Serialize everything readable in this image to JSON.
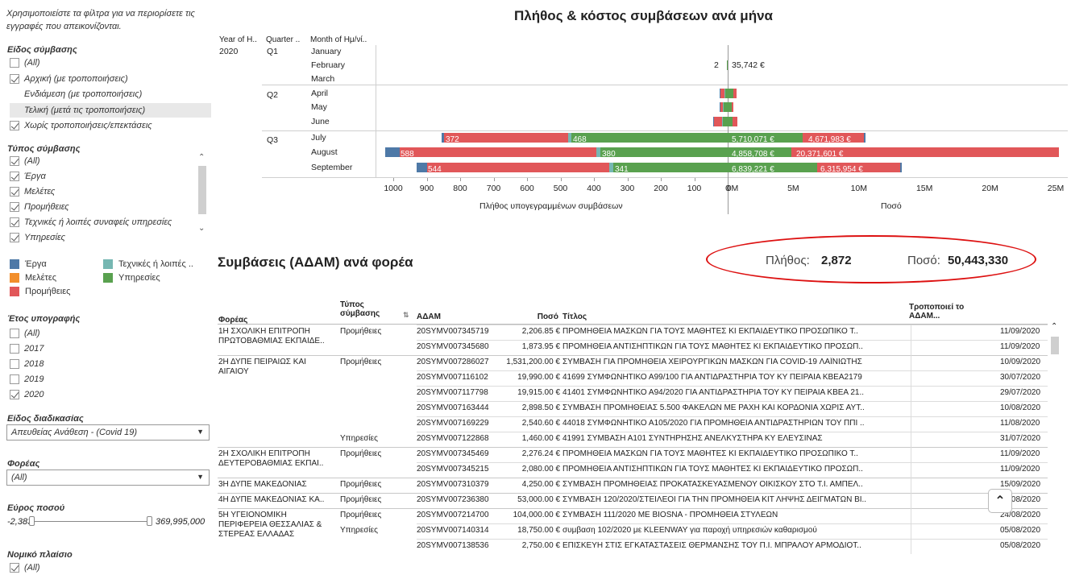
{
  "sidebar": {
    "note": "Χρησιμοποιείστε τα φίλτρα για να περιορίσετε τις εγγραφές που απεικονίζονται.",
    "contract_kind": {
      "title": "Είδος σύμβασης",
      "items": [
        {
          "label": "(All)",
          "checked": false
        },
        {
          "label": "Αρχική (με τροποποιήσεις)",
          "checked": true
        },
        {
          "label": "Ενδιάμεση (με τροποποιήσεις)",
          "checked": null
        },
        {
          "label": "Τελική (μετά τις τροποποιήσεις)",
          "checked": null
        },
        {
          "label": "Χωρίς τροποποιήσεις/επεκτάσεις",
          "checked": true
        }
      ]
    },
    "contract_type": {
      "title": "Τύπος σύμβασης",
      "items": [
        {
          "label": "(All)",
          "checked": true
        },
        {
          "label": "Έργα",
          "checked": true
        },
        {
          "label": "Μελέτες",
          "checked": true
        },
        {
          "label": "Προμήθειες",
          "checked": true
        },
        {
          "label": "Τεχνικές ή λοιπές συναφείς υπηρεσίες",
          "checked": true
        },
        {
          "label": "Υπηρεσίες",
          "checked": true
        }
      ]
    },
    "legend": [
      {
        "label": "Έργα",
        "color": "#4e79a7"
      },
      {
        "label": "Τεχνικές ή λοιπές ..",
        "color": "#76b7b2"
      },
      {
        "label": "Μελέτες",
        "color": "#f28e2b"
      },
      {
        "label": "Υπηρεσίες",
        "color": "#59a14f"
      },
      {
        "label": "Προμήθειες",
        "color": "#e15759"
      }
    ],
    "sign_year": {
      "title": "Έτος υπογραφής",
      "items": [
        {
          "label": "(All)",
          "checked": false
        },
        {
          "label": "2017",
          "checked": false
        },
        {
          "label": "2018",
          "checked": false
        },
        {
          "label": "2019",
          "checked": false
        },
        {
          "label": "2020",
          "checked": true
        }
      ]
    },
    "procedure": {
      "title": "Είδος διαδικασίας",
      "value": "Απευθείας Ανάθεση - (Covid 19)"
    },
    "body": {
      "title": "Φορέας",
      "value": "(All)"
    },
    "amount_range": {
      "title": "Εύρος ποσού",
      "min": "-2,383",
      "max": "369,995,000"
    },
    "legal": {
      "title": "Νομικό πλαίσιο",
      "first": "(All)"
    }
  },
  "chart": {
    "title": "Πλήθος & κόστος συμβάσεων ανά μήνα",
    "headers": {
      "year": "Year of H..",
      "quarter": "Quarter ..",
      "month": "Month of Ημ/νί.."
    },
    "year": "2020",
    "quarters": [
      "Q1",
      "Q2",
      "Q3"
    ],
    "left_axis_title": "Πλήθος υπογεγραμμένων συμβάσεων",
    "right_axis_title": "Ποσό",
    "left_ticks": [
      "1000",
      "900",
      "800",
      "700",
      "600",
      "500",
      "400",
      "300",
      "200",
      "100",
      "0"
    ],
    "right_ticks": [
      "0M",
      "5M",
      "10M",
      "15M",
      "20M",
      "25M"
    ]
  },
  "chart_data": {
    "type": "bar",
    "title": "Πλήθος & κόστος συμβάσεων ανά μήνα",
    "categories": [
      "January",
      "February",
      "March",
      "April",
      "May",
      "June",
      "July",
      "August",
      "September"
    ],
    "count_xlim": [
      0,
      1000
    ],
    "amount_xlim": [
      0,
      25000000
    ],
    "count_series": [
      {
        "name": "Έργα",
        "values": [
          0,
          0,
          0,
          3,
          2,
          3,
          8,
          45,
          30
        ]
      },
      {
        "name": "Τεχνικές ή λοιπές ..",
        "values": [
          0,
          0,
          0,
          2,
          2,
          2,
          8,
          12,
          14
        ]
      },
      {
        "name": "Υπηρεσίες",
        "values": [
          0,
          2,
          0,
          8,
          12,
          16,
          468,
          380,
          341
        ]
      },
      {
        "name": "Προμήθειες",
        "values": [
          0,
          0,
          0,
          12,
          8,
          22,
          372,
          588,
          544
        ]
      }
    ],
    "amount_series": [
      {
        "name": "Υπηρεσίες",
        "values": [
          0,
          35742,
          0,
          400000,
          300000,
          350000,
          5710071,
          4858708,
          6839221
        ]
      },
      {
        "name": "Προμήθειες",
        "values": [
          0,
          0,
          0,
          300000,
          150000,
          400000,
          4671983,
          20371601,
          6315954
        ]
      },
      {
        "name": "Έργα",
        "values": [
          0,
          0,
          0,
          0,
          0,
          0,
          100000,
          0,
          100000
        ]
      }
    ],
    "annotations": {
      "february_count": "2",
      "february_amount": "35,742 €"
    },
    "bar_labels": {
      "count_july": [
        "372",
        "468"
      ],
      "count_august": [
        "588",
        "380"
      ],
      "count_september": [
        "544",
        "341"
      ],
      "amount_july": [
        "5,710,071 €",
        "4,671,983 €"
      ],
      "amount_august": [
        "4,858,708 €",
        "20,371,601 €"
      ],
      "amount_september": [
        "6,839,221 €",
        "6,315,954 €"
      ]
    }
  },
  "kpi": {
    "title": "Συμβάσεις (ΑΔΑΜ) ανά φορέα",
    "count_label": "Πλήθος:",
    "count_value": "2,872",
    "amount_label": "Ποσό:",
    "amount_value": "50,443,330"
  },
  "table": {
    "headers": {
      "body": "Φορέας",
      "type": "Τύπος σύμβασης",
      "adam": "ΑΔΑΜ",
      "amount": "Ποσό",
      "title": "Τίτλος",
      "modifies": "Τροποποιεί το ΑΔΑΜ..."
    },
    "rows": [
      {
        "body": "1Η ΣΧΟΛΙΚΗ ΕΠΙΤΡΟΠΗ ΠΡΩΤΟΒΑΘΜΙΑΣ ΕΚΠΑΙΔΕ..",
        "type": "Προμήθειες",
        "adam": "20SYMV007345719",
        "amount": "2,206.85 €",
        "title": "ΠΡΟΜΗΘΕΙΑ  ΜΑΣΚΩΝ  ΓΙΑ ΤΟΥΣ ΜΑΘΗΤΕΣ ΚΙ ΕΚΠΑΙΔΕΥΤΙΚΟ ΠΡΟΣΩΠΙΚΟ Τ..",
        "date": "11/09/2020"
      },
      {
        "body": "",
        "type": "",
        "adam": "20SYMV007345680",
        "amount": "1,873.95 €",
        "title": "ΠΡΟΜΗΘΕΙΑ ΑΝΤΙΣΗΠΤΙΚΩΝ  ΓΙΑ ΤΟΥΣ ΜΑΘΗΤΕΣ ΚΙ ΕΚΠΑΙΔΕΥΤΙΚΟ ΠΡΟΣΩΠ..",
        "date": "11/09/2020"
      },
      {
        "body": "2Η ΔΥΠΕ ΠΕΙΡΑΙΩΣ ΚΑΙ ΑΙΓΑΙΟΥ",
        "type": "Προμήθειες",
        "adam": "20SYMV007286027",
        "amount": "1,531,200.00 €",
        "title": "ΣΥΜΒΑΣΗ ΓΙΑ ΠΡΟΜΗΘΕΙΑ ΧΕΙΡΟΥΡΓΙΚΩΝ ΜΑΣΚΩΝ ΓΙΑ COVID-19 ΛΑΪΝΙΩΤΗΣ",
        "date": "10/09/2020"
      },
      {
        "body": "",
        "type": "",
        "adam": "20SYMV007116102",
        "amount": "19,990.00 €",
        "title": "41699 ΣΥΜΦΩΝΗΤΙΚΟ Α99/100 ΓΙΑ ΑΝΤΙΔΡΑΣΤΗΡΙΑ ΤΟΥ ΚΥ ΠΕΙΡΑΙΑ ΚΒΕΑ2179",
        "date": "30/07/2020"
      },
      {
        "body": "",
        "type": "",
        "adam": "20SYMV007117798",
        "amount": "19,915.00 €",
        "title": "41401 ΣΥΜΦΩΝΗΤΙΚΟ Α94/2020 ΓΙΑ ΑΝΤΙΔΡΑΣΤΗΡΙΑ ΤΟΥ ΚΥ ΠΕΙΡΑΙΑ ΚΒΕΑ 21..",
        "date": "29/07/2020"
      },
      {
        "body": "",
        "type": "",
        "adam": "20SYMV007163444",
        "amount": "2,898.50 €",
        "title": "ΣΥΜΒΑΣΗ ΠΡΟΜΗΘΕΙΑΣ 5.500 ΦΑΚΕΛΩΝ ΜΕ ΡΑΧΗ ΚΑΙ ΚΟΡΔΟΝΙΑ ΧΩΡΙΣ ΑΥΤ..",
        "date": "10/08/2020"
      },
      {
        "body": "",
        "type": "",
        "adam": "20SYMV007169229",
        "amount": "2,540.60 €",
        "title": "44018 ΣΥΜΦΩΝΗΤΙΚΟ Α105/2020 ΓΙΑ ΠΡΟΜΗΘΕΙΑ ΑΝΤΙΔΡΑΣΤΗΡΙΩΝ ΤΟΥ ΠΠΙ ..",
        "date": "11/08/2020"
      },
      {
        "body": "",
        "type": "Υπηρεσίες",
        "adam": "20SYMV007122868",
        "amount": "1,460.00 €",
        "title": "41991 ΣΥΜΒΑΣΗ Α101 ΣΥΝΤΗΡΗΣΗΣ ΑΝΕΛΚΥΣΤΗΡΑ ΚΥ ΕΛΕΥΣΙΝΑΣ",
        "date": "31/07/2020"
      },
      {
        "body": "2Η ΣΧΟΛΙΚΗ ΕΠΙΤΡΟΠΗ ΔΕΥΤΕΡΟΒΑΘΜΙΑΣ ΕΚΠΑΙ..",
        "type": "Προμήθειες",
        "adam": "20SYMV007345469",
        "amount": "2,276.24 €",
        "title": "ΠΡΟΜΗΘΕΙΑ  ΜΑΣΚΩΝ  ΓΙΑ ΤΟΥΣ ΜΑΘΗΤΕΣ ΚΙ ΕΚΠΑΙΔΕΥΤΙΚΟ ΠΡΟΣΩΠΙΚΟ Τ..",
        "date": "11/09/2020"
      },
      {
        "body": "",
        "type": "",
        "adam": "20SYMV007345215",
        "amount": "2,080.00 €",
        "title": "ΠΡΟΜΗΘΕΙΑ ΑΝΤΙΣΗΠΤΙΚΩΝ  ΓΙΑ ΤΟΥΣ ΜΑΘΗΤΕΣ ΚΙ ΕΚΠΑΙΔΕΥΤΙΚΟ ΠΡΟΣΩΠ..",
        "date": "11/09/2020"
      },
      {
        "body": "3Η ΔΥΠΕ ΜΑΚΕΔΟΝΙΑΣ",
        "type": "Προμήθειες",
        "adam": "20SYMV007310379",
        "amount": "4,250.00 €",
        "title": "ΣΥΜΒΑΣΗ ΠΡΟΜΗΘΕΙΑΣ ΠΡΟΚΑΤΑΣΚΕΥΑΣΜΕΝΟΥ ΟΙΚΙΣΚΟΥ ΣΤΟ Τ.Ι. ΑΜΠΕΛ..",
        "date": "15/09/2020"
      },
      {
        "body": "4Η ΔΥΠΕ ΜΑΚΕΔΟΝΙΑΣ ΚΑ..",
        "type": "Προμήθειες",
        "adam": "20SYMV007236380",
        "amount": "53,000.00 €",
        "title": "ΣΥΜΒΑΣΗ 120/2020/ΣΤΕΙΛΕΟΙ ΓΙΑ ΤΗΝ ΠΡΟΜΗΘΕΙΑ ΚΙΤ ΛΗΨΗΣ ΔΕΙΓΜΑΤΩΝ ΒΙ..",
        "date": "28/08/2020"
      },
      {
        "body": "5Η ΥΓΕΙΟΝΟΜΙΚΗ ΠΕΡΙΦΕΡΕΙΑ ΘΕΣΣΑΛΙΑΣ & ΣΤΕΡΕΑΣ ΕΛΛΑΔΑΣ",
        "type": "Προμήθειες",
        "adam": "20SYMV007214700",
        "amount": "104,000.00 €",
        "title": "ΣΥΜΒΑΣΗ 111/2020 ΜΕ BIOSNA - ΠΡΟΜΗΘΕΙΑ ΣΤΥΛΕΩΝ",
        "date": "24/08/2020"
      },
      {
        "body": "",
        "type": "Υπηρεσίες",
        "adam": "20SYMV007140314",
        "amount": "18,750.00 €",
        "title": "συμβαση 102/2020 με KLEENWAY για παροχή υπηρεσιών καθαρισμού",
        "date": "05/08/2020"
      },
      {
        "body": "",
        "type": "",
        "adam": "20SYMV007138536",
        "amount": "2,750.00 €",
        "title": "ΕΠΙΣΚΕΥΗ ΣΤΙΣ ΕΓΚΑΤΑΣΤΑΣΕΙΣ ΘΕΡΜΑΝΣΗΣ ΤΟΥ Π.Ι. ΜΠΡΑΛΟΥ ΑΡΜΟΔΙΟΤ..",
        "date": "05/08/2020"
      }
    ]
  }
}
